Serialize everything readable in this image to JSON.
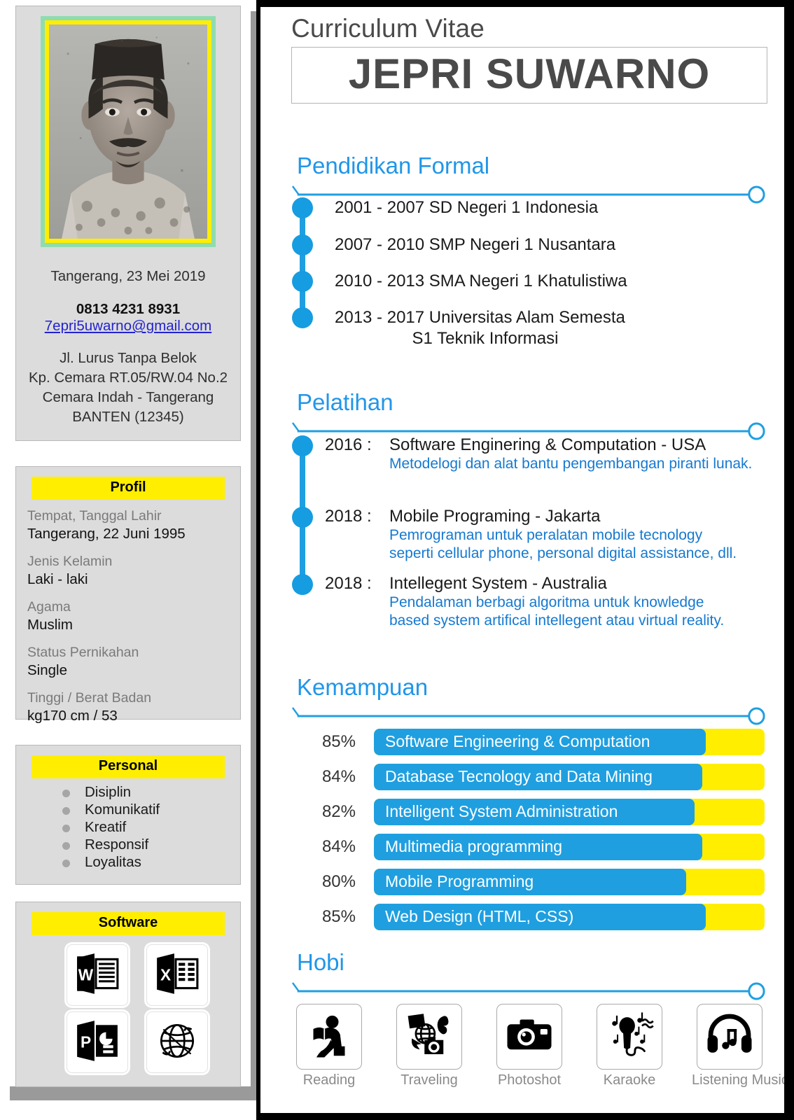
{
  "header": {
    "cv_label": "Curriculum Vitae",
    "name": "JEPRI SUWARNO"
  },
  "sidebar": {
    "photo_alt": "portrait-photo",
    "contact": {
      "place_date": "Tangerang, 23 Mei 2019",
      "phone": "0813 4231 8931",
      "email": "7epri5uwarno@gmail.com",
      "address_lines": [
        "Jl. Lurus Tanpa Belok",
        "Kp. Cemara RT.05/RW.04 No.2",
        "Cemara Indah - Tangerang",
        "BANTEN (12345)"
      ]
    },
    "profil": {
      "title": "Profil",
      "fields": [
        {
          "label": "Tempat, Tanggal Lahir",
          "value": "Tangerang, 22 Juni 1995"
        },
        {
          "label": "Jenis Kelamin",
          "value": "Laki - laki"
        },
        {
          "label": "Agama",
          "value": "Muslim"
        },
        {
          "label": "Status Pernikahan",
          "value": "Single"
        },
        {
          "label": "Tinggi / Berat Badan",
          "value": "kg170 cm / 53"
        }
      ]
    },
    "personal": {
      "title": "Personal",
      "items": [
        "Disiplin",
        "Komunikatif",
        "Kreatif",
        "Responsif",
        "Loyalitas"
      ]
    },
    "software": {
      "title": "Software",
      "items": [
        {
          "icon": "word-icon",
          "name": "Microsoft Word"
        },
        {
          "icon": "excel-icon",
          "name": "Microsoft Excel"
        },
        {
          "icon": "powerpoint-icon",
          "name": "Microsoft PowerPoint"
        },
        {
          "icon": "internet-globe-icon",
          "name": "Internet"
        }
      ]
    }
  },
  "sections": {
    "education": {
      "title": "Pendidikan Formal",
      "items": [
        {
          "text": "2001 - 2007 SD Negeri 1 Indonesia",
          "sub": ""
        },
        {
          "text": "2007 - 2010 SMP Negeri 1 Nusantara",
          "sub": ""
        },
        {
          "text": "2010 - 2013 SMA Negeri 1 Khatulistiwa",
          "sub": ""
        },
        {
          "text": "2013 - 2017 Universitas Alam Semesta",
          "sub": "S1 Teknik Informasi"
        }
      ]
    },
    "training": {
      "title": "Pelatihan",
      "items": [
        {
          "year": "2016 :",
          "title": "Software Enginering & Computation - USA",
          "desc": [
            "Metodelogi dan alat bantu pengembangan piranti lunak."
          ]
        },
        {
          "year": "2018 :",
          "title": "Mobile Programing - Jakarta",
          "desc": [
            "Pemrograman untuk peralatan mobile tecnology",
            "seperti cellular phone, personal digital assistance, dll."
          ]
        },
        {
          "year": "2018 :",
          "title": "Intellegent System - Australia",
          "desc": [
            "Pendalaman berbagi algoritma untuk knowledge",
            "based system artifical intellegent atau virtual reality."
          ]
        }
      ]
    },
    "skills": {
      "title": "Kemampuan",
      "items": [
        {
          "pct": "85%",
          "value": 85,
          "name": "Software Engineering & Computation"
        },
        {
          "pct": "84%",
          "value": 84,
          "name": "Database Tecnology and Data Mining"
        },
        {
          "pct": "82%",
          "value": 82,
          "name": "Intelligent System Administration"
        },
        {
          "pct": "84%",
          "value": 84,
          "name": "Multimedia programming"
        },
        {
          "pct": "80%",
          "value": 80,
          "name": "Mobile Programming"
        },
        {
          "pct": "85%",
          "value": 85,
          "name": "Web Design (HTML, CSS)"
        }
      ]
    },
    "hobbies": {
      "title": "Hobi",
      "items": [
        {
          "label": "Reading",
          "icon": "reading-icon"
        },
        {
          "label": "Traveling",
          "icon": "traveling-icon"
        },
        {
          "label": "Photoshot",
          "icon": "camera-icon"
        },
        {
          "label": "Karaoke",
          "icon": "microphone-icon"
        },
        {
          "label": "Listening Music",
          "icon": "headphones-icon"
        }
      ]
    }
  },
  "colors": {
    "accent_blue": "#1f9fe0",
    "highlight_yellow": "#ffee00",
    "link_blue": "#2323cf",
    "desc_blue": "#1579d0",
    "sidebar_bg": "#dcdcdc"
  }
}
